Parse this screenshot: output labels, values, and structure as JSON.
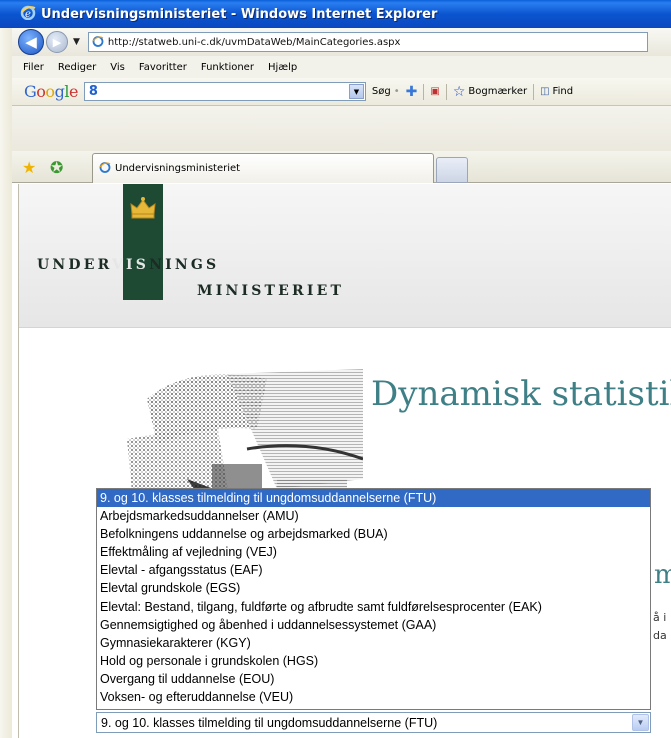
{
  "window": {
    "title": "Undervisningsministeriet - Windows Internet Explorer"
  },
  "address": {
    "url": "http://statweb.uni-c.dk/uvmDataWeb/MainCategories.aspx"
  },
  "menu": [
    "Filer",
    "Rediger",
    "Vis",
    "Favoritter",
    "Funktioner",
    "Hjælp"
  ],
  "google_toolbar": {
    "logo": "Google",
    "search_logo": "8",
    "search_label": "Søg",
    "bookmarks_label": "Bogmærker",
    "find_label": "Find"
  },
  "tab": {
    "label": "Undervisningsministeriet"
  },
  "logo": {
    "line1_a": "UNDER",
    "line1_b": "VIS",
    "line1_c": "NINGS",
    "line2": "MINISTERIET"
  },
  "page": {
    "title": "Dynamisk statistik",
    "peek_letter": "m",
    "peek_line1": "å i",
    "peek_line2": "da"
  },
  "category_list": {
    "options": [
      "9. og 10. klasses tilmelding til ungdomsuddannelserne (FTU)",
      "Arbejdsmarkedsuddannelser (AMU)",
      "Befolkningens uddannelse og arbejdsmarked (BUA)",
      "Effektmåling af vejledning (VEJ)",
      "Elevtal - afgangsstatus (EAF)",
      "Elevtal grundskole (EGS)",
      "Elevtal: Bestand, tilgang, fuldførte og afbrudte samt fuldførelsesprocenter (EAK)",
      "Gennemsigtighed og åbenhed i uddannelsessystemet (GAA)",
      "Gymnasiekarakterer (KGY)",
      "Hold og personale i grundskolen (HGS)",
      "Overgang til uddannelse (EOU)",
      "Voksen- og efteruddannelse (VEU)"
    ],
    "selected": "9. og 10. klasses tilmelding til ungdomsuddannelserne (FTU)"
  },
  "colors": {
    "selection": "#316ac5",
    "title_teal": "#3f7f86",
    "logo_green": "#1e4a33"
  },
  "icons": [
    "ie-logo-icon",
    "back-icon",
    "forward-icon",
    "favorites-star-icon",
    "add-favorite-icon",
    "chevron-down-icon"
  ]
}
